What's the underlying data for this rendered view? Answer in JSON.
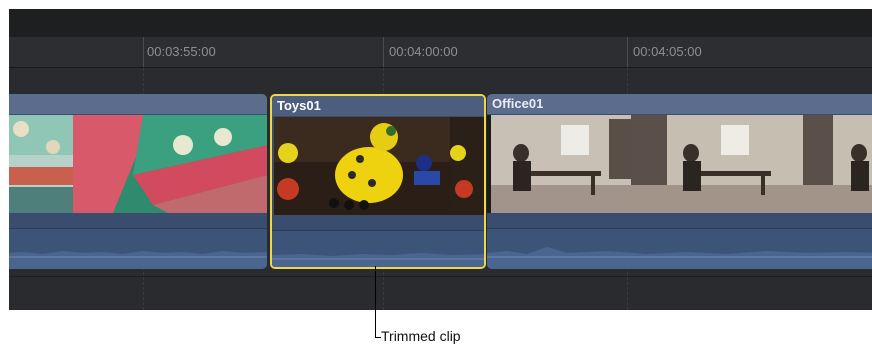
{
  "ruler": {
    "timecodes": [
      "00:03:55:00",
      "00:04:00:00",
      "00:04:05:00"
    ]
  },
  "clips": {
    "left_clip": {
      "name": ""
    },
    "toys": {
      "name": "Toys01",
      "selected": true
    },
    "office": {
      "name": "Office01"
    }
  },
  "colors": {
    "selection": "#ecd84a",
    "clip_header": "#5b6c8c",
    "audio": "#3c5478",
    "timeline_bg": "#2b2c2f"
  },
  "callout": {
    "label": "Trimmed clip"
  }
}
